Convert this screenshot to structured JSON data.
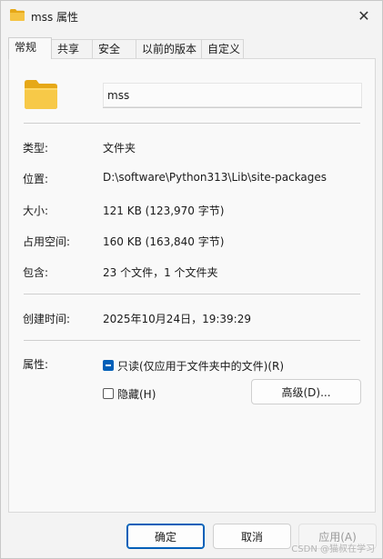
{
  "window": {
    "title": "mss 属性",
    "close_glyph": "✕"
  },
  "tabs": [
    {
      "label": "常规",
      "active": true
    },
    {
      "label": "共享",
      "active": false
    },
    {
      "label": "安全",
      "active": false
    },
    {
      "label": "以前的版本",
      "active": false
    },
    {
      "label": "自定义",
      "active": false
    }
  ],
  "general": {
    "name_value": "mss",
    "type_label": "类型:",
    "type_value": "文件夹",
    "location_label": "位置:",
    "location_value": "D:\\software\\Python313\\Lib\\site-packages",
    "size_label": "大小:",
    "size_value": "121 KB (123,970 字节)",
    "disk_size_label": "占用空间:",
    "disk_size_value": "160 KB (163,840 字节)",
    "contains_label": "包含:",
    "contains_value": "23 个文件，1 个文件夹",
    "created_label": "创建时间:",
    "created_value": "2025年10月24日，19:39:29",
    "attributes_label": "属性:",
    "readonly_label": "只读(仅应用于文件夹中的文件)(R)",
    "readonly_state": "indeterminate",
    "hidden_label": "隐藏(H)",
    "hidden_state": "unchecked",
    "advanced_label": "高级(D)..."
  },
  "footer": {
    "ok_label": "确定",
    "cancel_label": "取消",
    "apply_label": "应用(A)",
    "watermark": "CSDN @猫叔在学习"
  },
  "colors": {
    "accent": "#005fb8",
    "folder_yellow": "#f5c342",
    "folder_dark": "#e6a817"
  }
}
